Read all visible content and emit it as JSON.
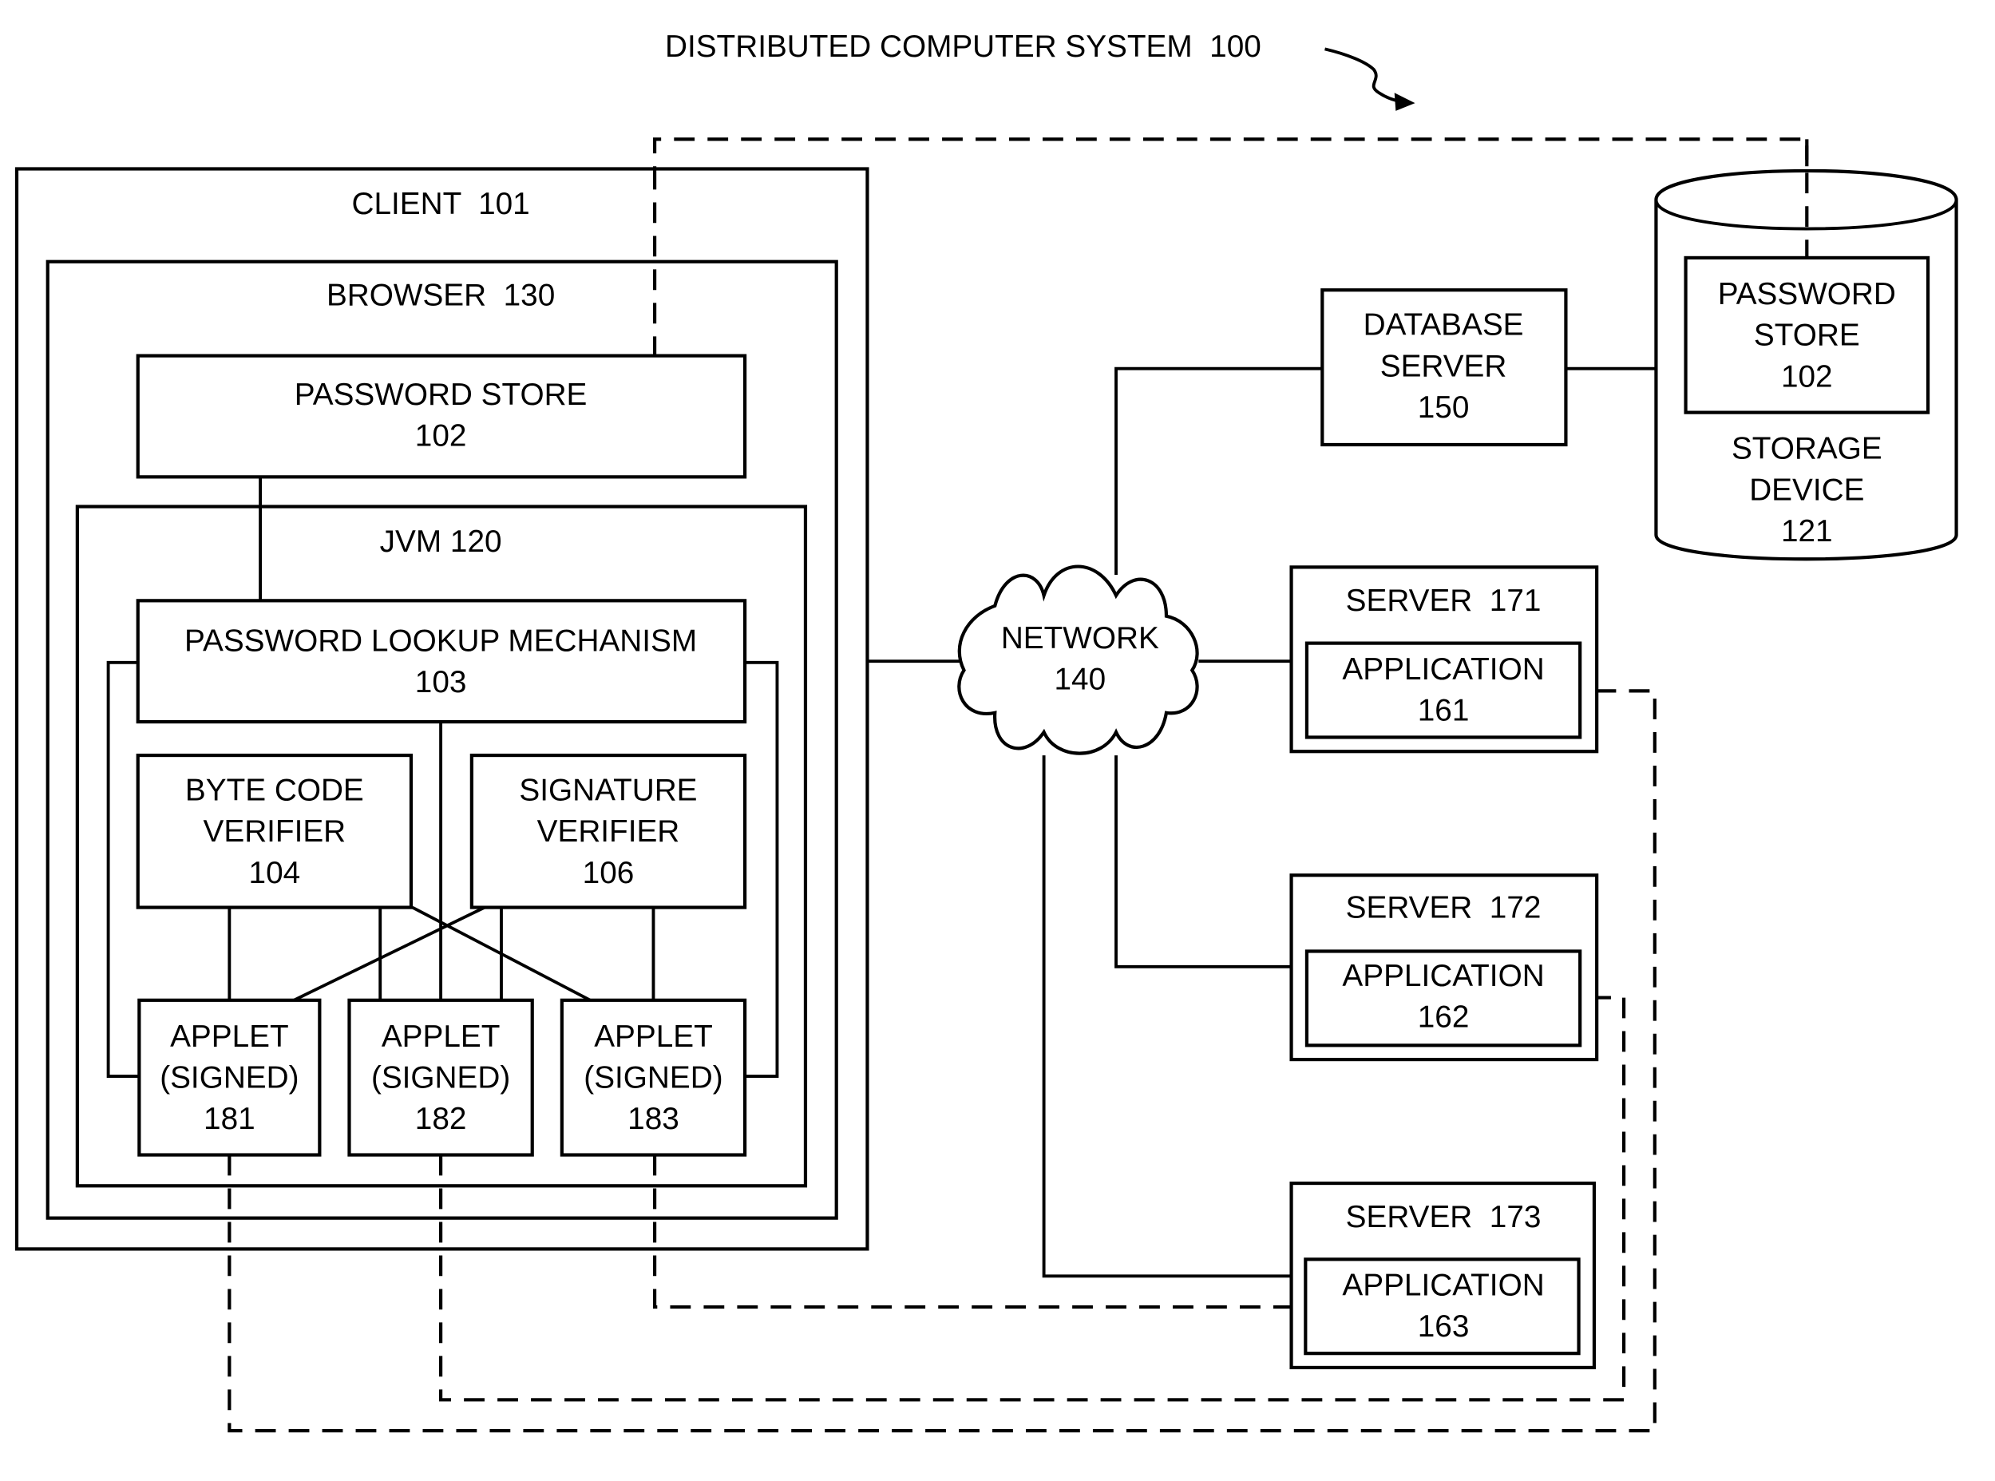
{
  "diagram": {
    "title": "DISTRIBUTED COMPUTER SYSTEM  100",
    "client": {
      "label": "CLIENT  101"
    },
    "browser": {
      "label": "BROWSER  130"
    },
    "password_store_client": {
      "line1": "PASSWORD STORE",
      "line2": "102"
    },
    "jvm": {
      "label": "JVM 120"
    },
    "lookup": {
      "line1": "PASSWORD LOOKUP MECHANISM",
      "line2": "103"
    },
    "bytecode_verifier": {
      "line1": "BYTE CODE",
      "line2": "VERIFIER",
      "line3": "104"
    },
    "signature_verifier": {
      "line1": "SIGNATURE",
      "line2": "VERIFIER",
      "line3": "106"
    },
    "applets": [
      {
        "line1": "APPLET",
        "line2": "(SIGNED)",
        "line3": "181"
      },
      {
        "line1": "APPLET",
        "line2": "(SIGNED)",
        "line3": "182"
      },
      {
        "line1": "APPLET",
        "line2": "(SIGNED)",
        "line3": "183"
      }
    ],
    "network": {
      "line1": "NETWORK",
      "line2": "140"
    },
    "database_server": {
      "line1": "DATABASE",
      "line2": "SERVER",
      "line3": "150"
    },
    "storage": {
      "store_line1": "PASSWORD",
      "store_line2": "STORE",
      "store_line3": "102",
      "line1": "STORAGE",
      "line2": "DEVICE",
      "line3": "121"
    },
    "servers": [
      {
        "label": "SERVER  171",
        "app_line1": "APPLICATION",
        "app_line2": "161"
      },
      {
        "label": "SERVER  172",
        "app_line1": "APPLICATION",
        "app_line2": "162"
      },
      {
        "label": "SERVER  173",
        "app_line1": "APPLICATION",
        "app_line2": "163"
      }
    ]
  }
}
